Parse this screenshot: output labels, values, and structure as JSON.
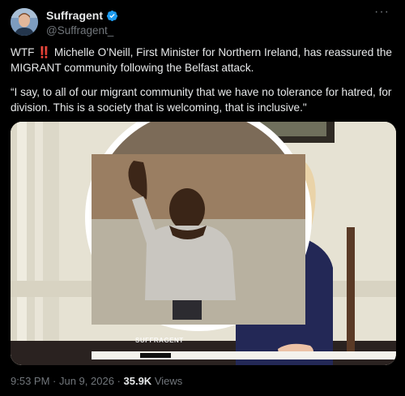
{
  "author": {
    "display_name": "Suffragent",
    "handle": "@Suffragent_",
    "verified": true,
    "more_icon": "more-horizontal-icon"
  },
  "tweet": {
    "prefix": "WTF ",
    "emoji": "‼️",
    "line1": " Michelle O’Neill, First Minister for Northern Ireland, has reassured the MIGRANT community following the Belfast attack.",
    "quote": "“I say, to all of our migrant community that we have no tolerance for hatred, for division. This is a society that is welcoming, that is inclusive.\""
  },
  "media": {
    "watermark": "SUFFRAGENT"
  },
  "meta": {
    "time": "9:53 PM",
    "sep1": " · ",
    "date": "Jun 9, 2026",
    "sep2": " · ",
    "views_count": "35.9K",
    "views_label": " Views"
  },
  "colors": {
    "background": "#000000",
    "text": "#e7e9ea",
    "secondary": "#71767b",
    "verified": "#1d9bf0"
  }
}
